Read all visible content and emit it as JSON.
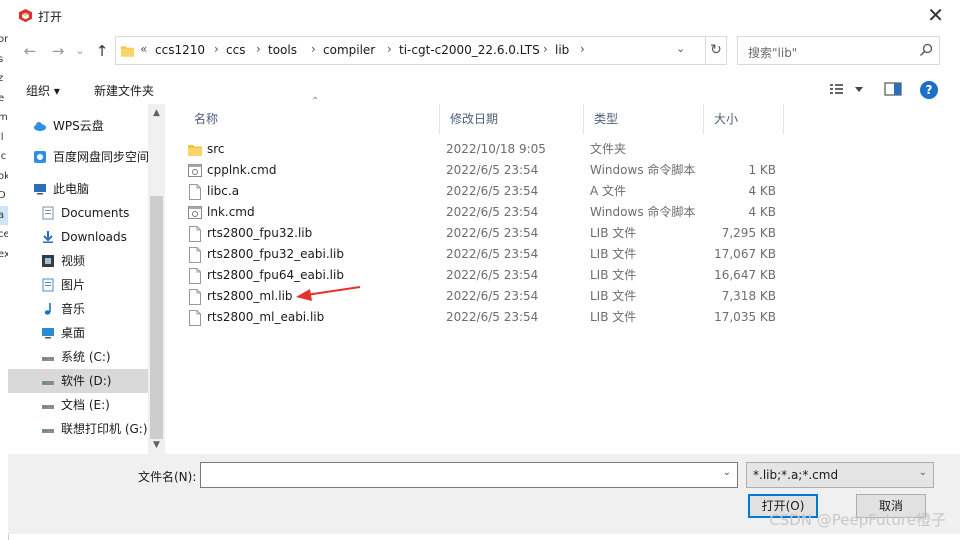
{
  "window": {
    "title": "打开",
    "close": "✕"
  },
  "background_strip": [
    "on",
    "s",
    "z",
    "e",
    "m",
    "ll",
    "ic",
    "ok",
    "D",
    "a",
    "ce",
    "ex"
  ],
  "address": {
    "crumbs": [
      "ccs1210",
      "ccs",
      "tools",
      "compiler",
      "ti-cgt-c2000_22.6.0.LTS",
      "lib"
    ],
    "lead": "«",
    "separator": "›"
  },
  "search": {
    "placeholder": "搜索\"lib\""
  },
  "toolbar": {
    "organize": "组织 ▾",
    "new_folder": "新建文件夹",
    "help": "?"
  },
  "nav": [
    {
      "label": "WPS云盘",
      "icon": "cloud-icon",
      "color": "#2f8fe6"
    },
    {
      "label": "百度网盘同步空间",
      "icon": "baidu-sync-icon",
      "color": "#2f8fe6"
    },
    {
      "label": "此电脑",
      "icon": "computer-icon",
      "color": "#2a6fb8"
    },
    {
      "label": "Documents",
      "icon": "documents-icon",
      "color": "#7c8da3"
    },
    {
      "label": "Downloads",
      "icon": "download-icon",
      "color": "#2a6fb8"
    },
    {
      "label": "视频",
      "icon": "video-icon",
      "color": "#3b3b3b"
    },
    {
      "label": "图片",
      "icon": "pictures-icon",
      "color": "#4a8cc4"
    },
    {
      "label": "音乐",
      "icon": "music-icon",
      "color": "#1a6fc9"
    },
    {
      "label": "桌面",
      "icon": "desktop-icon",
      "color": "#2a8ad0"
    },
    {
      "label": "系统 (C:)",
      "icon": "drive-c-icon",
      "color": "#555"
    },
    {
      "label": "软件 (D:)",
      "icon": "drive-d-icon",
      "color": "#555",
      "selected": true
    },
    {
      "label": "文档 (E:)",
      "icon": "drive-e-icon",
      "color": "#555"
    },
    {
      "label": "联想打印机 (G:)",
      "icon": "drive-g-icon",
      "color": "#555"
    }
  ],
  "columns": {
    "name": "名称",
    "date": "修改日期",
    "type": "类型",
    "size": "大小"
  },
  "files": [
    {
      "name": "src",
      "date": "2022/10/18 9:05",
      "type": "文件夹",
      "size": "",
      "kind": "folder"
    },
    {
      "name": "cpplnk.cmd",
      "date": "2022/6/5 23:54",
      "type": "Windows 命令脚本",
      "size": "1 KB",
      "kind": "cmd"
    },
    {
      "name": "libc.a",
      "date": "2022/6/5 23:54",
      "type": "A 文件",
      "size": "4 KB",
      "kind": "file"
    },
    {
      "name": "lnk.cmd",
      "date": "2022/6/5 23:54",
      "type": "Windows 命令脚本",
      "size": "4 KB",
      "kind": "cmd"
    },
    {
      "name": "rts2800_fpu32.lib",
      "date": "2022/6/5 23:54",
      "type": "LIB 文件",
      "size": "7,295 KB",
      "kind": "file"
    },
    {
      "name": "rts2800_fpu32_eabi.lib",
      "date": "2022/6/5 23:54",
      "type": "LIB 文件",
      "size": "17,067 KB",
      "kind": "file"
    },
    {
      "name": "rts2800_fpu64_eabi.lib",
      "date": "2022/6/5 23:54",
      "type": "LIB 文件",
      "size": "16,647 KB",
      "kind": "file"
    },
    {
      "name": "rts2800_ml.lib",
      "date": "2022/6/5 23:54",
      "type": "LIB 文件",
      "size": "7,318 KB",
      "kind": "file"
    },
    {
      "name": "rts2800_ml_eabi.lib",
      "date": "2022/6/5 23:54",
      "type": "LIB 文件",
      "size": "17,035 KB",
      "kind": "file"
    }
  ],
  "bottom": {
    "filename_label": "文件名(N):",
    "filename_value": "",
    "filter": "*.lib;*.a;*.cmd",
    "open": "打开(O)",
    "cancel": "取消"
  },
  "watermark": "CSDN @PeepFuture橙子",
  "colors": {
    "accent": "#0078d7",
    "annotation_arrow": "#e8302c"
  }
}
